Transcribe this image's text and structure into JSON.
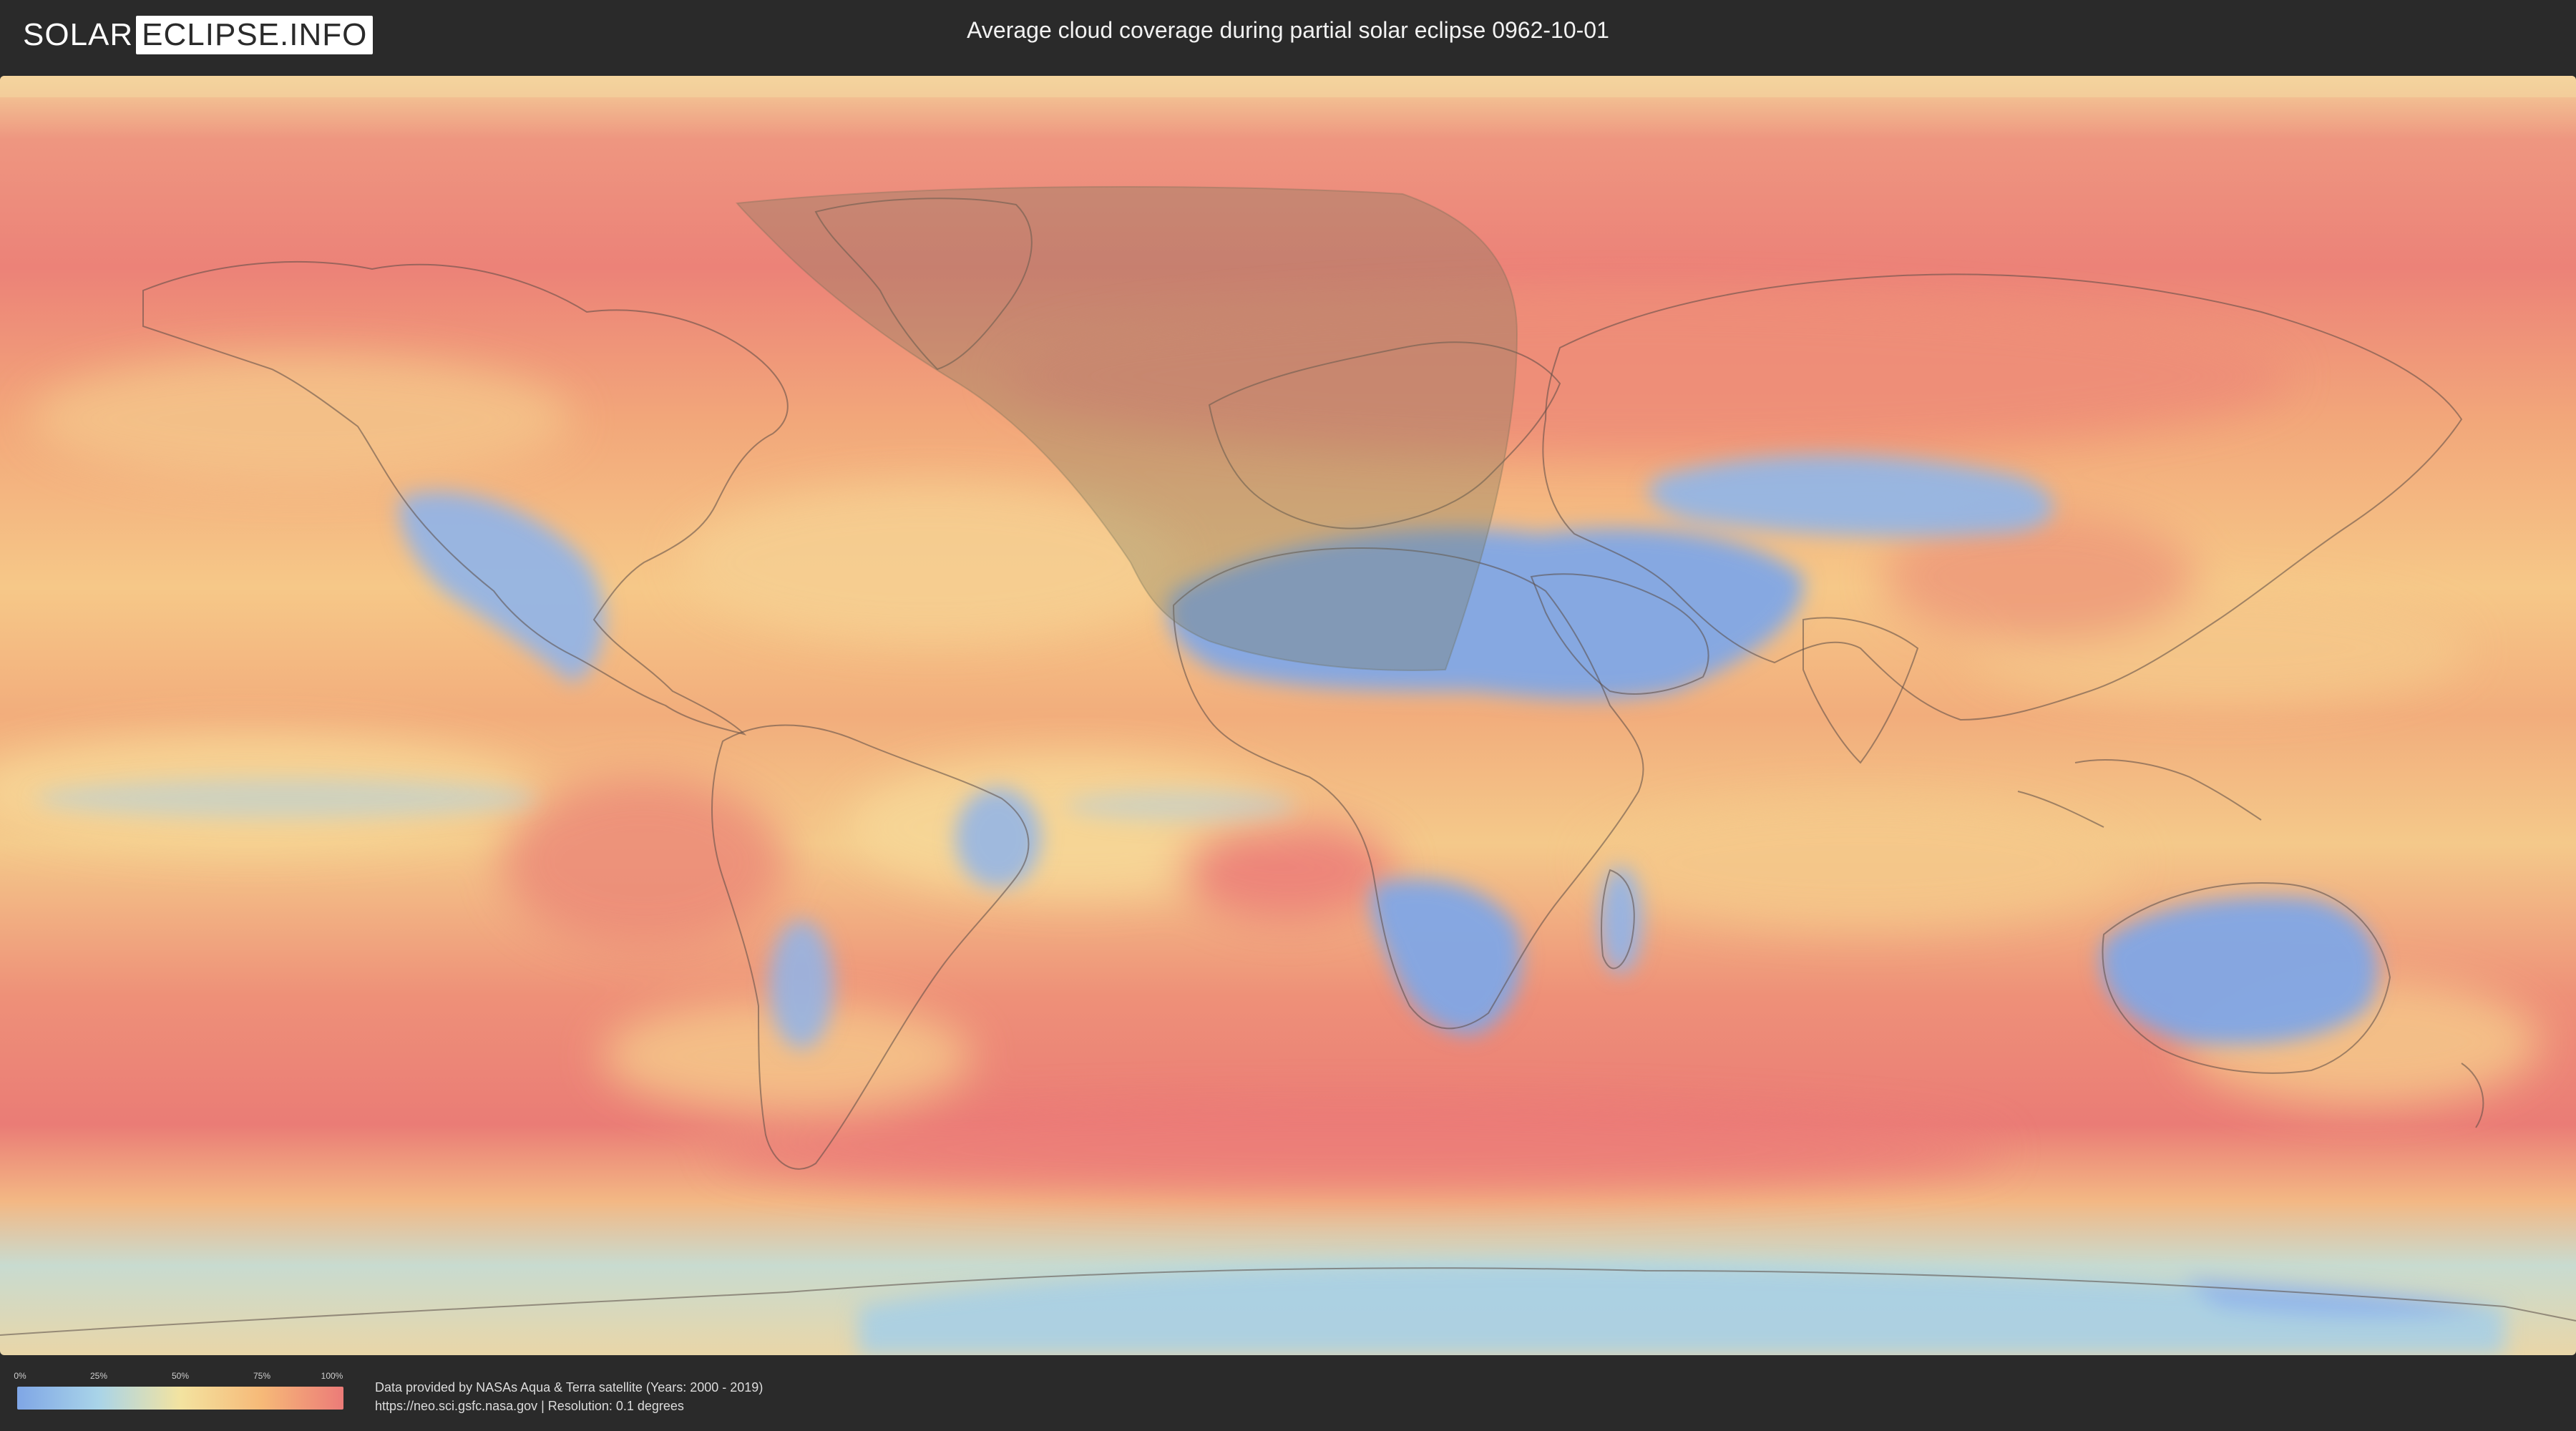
{
  "header": {
    "logo_part1": "SOLAR",
    "logo_part2": "ECLIPSE.INFO",
    "title": "Average cloud coverage during partial solar eclipse 0962-10-01"
  },
  "legend": {
    "ticks": [
      "0%",
      "25%",
      "50%",
      "75%",
      "100%"
    ],
    "colors": [
      "#7fa6e6",
      "#a9d4e8",
      "#f3e3a0",
      "#f6b978",
      "#ec7b78"
    ]
  },
  "footer": {
    "credit_line1": "Data provided by NASAs Aqua & Terra satellite (Years: 2000 - 2019)",
    "credit_line2": "https://neo.sci.gsfc.nasa.gov | Resolution: 0.1 degrees"
  },
  "colors": {
    "background": "#2a2a2a",
    "eclipse_shadow": "#8a8a6a",
    "clear_sky": "#7fa6e6",
    "overcast": "#ec7b78"
  }
}
